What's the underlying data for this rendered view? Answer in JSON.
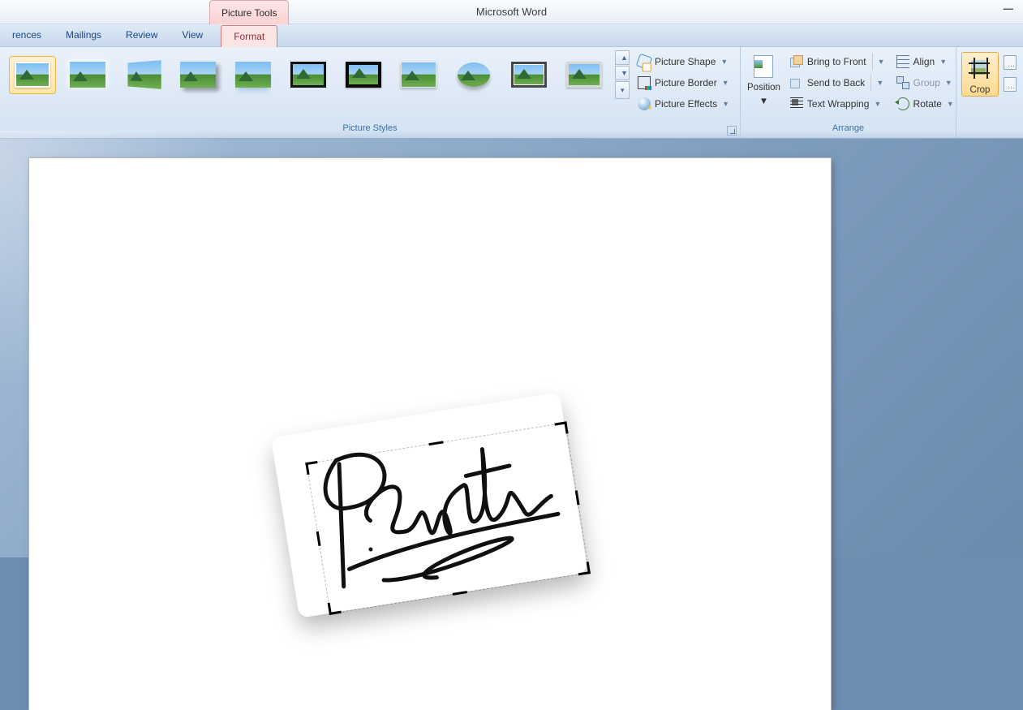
{
  "app": {
    "title": "Microsoft Word",
    "contextual_tab": "Picture Tools"
  },
  "tabs": {
    "references": "rences",
    "mailings": "Mailings",
    "review": "Review",
    "view": "View",
    "format": "Format"
  },
  "ribbon": {
    "styles_group": "Picture Styles",
    "arrange_group": "Arrange",
    "picture_shape": "Picture Shape",
    "picture_border": "Picture Border",
    "picture_effects": "Picture Effects",
    "position": "Position",
    "bring_to_front": "Bring to Front",
    "send_to_back": "Send to Back",
    "text_wrapping": "Text Wrapping",
    "align": "Align",
    "group": "Group",
    "rotate": "Rotate",
    "crop": "Crop"
  },
  "document": {
    "signature_text": "P. Smith"
  }
}
